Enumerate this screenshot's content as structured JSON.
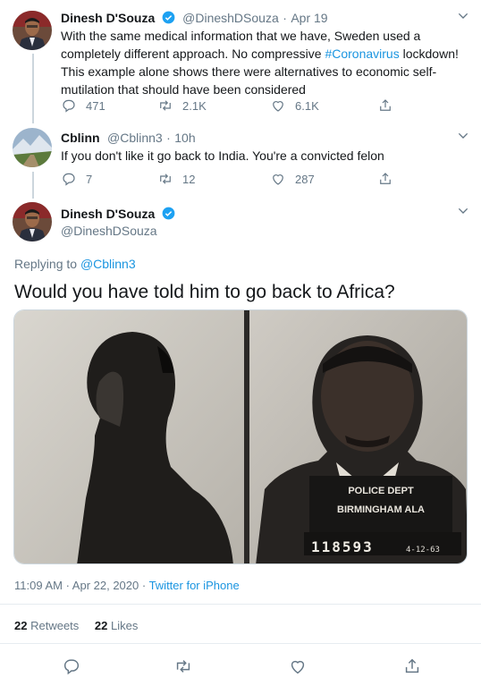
{
  "tweet1": {
    "name": "Dinesh D'Souza",
    "handle": "@DineshDSouza",
    "sep": "·",
    "time": "Apr 19",
    "text_before": "With the same medical information that we have, Sweden used a completely different approach. No compressive ",
    "hashtag": "#Coronavirus",
    "text_after": " lockdown! This example alone shows there were alternatives to economic self-mutilation that should have been considered",
    "replies": "471",
    "retweets": "2.1K",
    "likes": "6.1K"
  },
  "tweet2": {
    "name": "Cblinn",
    "handle": "@Cblinn3",
    "sep": "·",
    "time": "10h",
    "text": "If you don't like it go back to India. You're a convicted felon",
    "replies": "7",
    "retweets": "12",
    "likes": "287"
  },
  "main_tweet": {
    "name": "Dinesh D'Souza",
    "handle": "@DineshDSouza",
    "replying_prefix": "Replying to ",
    "replying_handle": "@Cblinn3",
    "text": "Would you have told him to go back to Africa?",
    "photo_text": {
      "line1": "POLICE DEPT",
      "line2": "BIRMINGHAM ALA",
      "number": "118593",
      "suffix": "4-12-63"
    },
    "timestamp": "11:09 AM · Apr 22, 2020 · ",
    "source": "Twitter for iPhone",
    "retweet_count": "22",
    "retweet_label": "Retweets",
    "like_count": "22",
    "like_label": "Likes"
  },
  "colors": {
    "link": "#1b95e0",
    "secondary": "#657786",
    "verified": "#1da1f2"
  },
  "icons": {
    "reply": "reply-icon",
    "retweet": "retweet-icon",
    "like": "heart-icon",
    "share": "share-icon",
    "more": "chevron-down-icon",
    "verified": "verified-badge-icon"
  }
}
